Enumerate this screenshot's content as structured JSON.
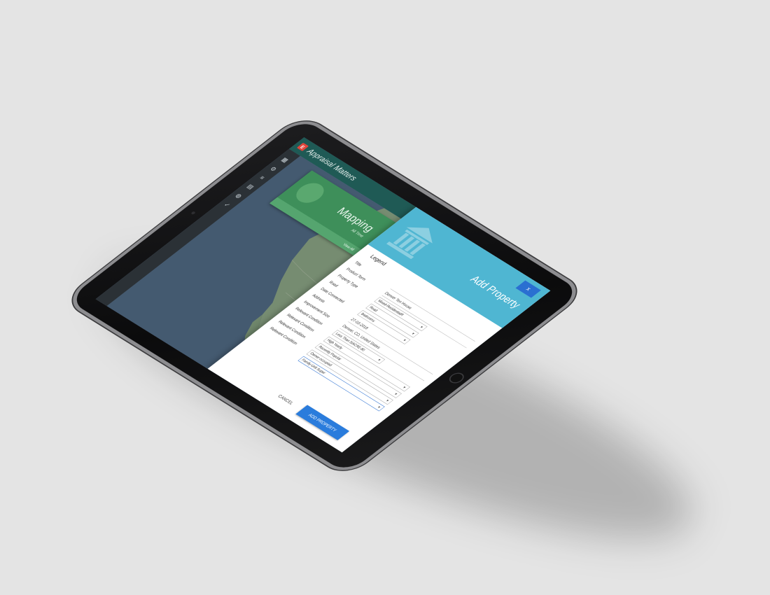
{
  "app": {
    "title": "Appraisal Matters",
    "logo": "E"
  },
  "toolbar": {
    "icons": [
      "grid-icon",
      "settings-icon",
      "layers-icon",
      "calendar-icon",
      "globe-icon",
      "check-icon"
    ]
  },
  "mapping_card": {
    "title": "Mapping",
    "subtitle": "All Time",
    "footer": "View All"
  },
  "dialog": {
    "title": "Add Property",
    "close_label": "x",
    "legend": "Legend",
    "fields": [
      {
        "label": "Title",
        "value": "",
        "kind": "line"
      },
      {
        "label": "Product Term",
        "value": "Denver Ten House",
        "kind": "line"
      },
      {
        "label": "Property Type",
        "value": "Mixed-ResidentialR",
        "kind": "select"
      },
      {
        "label": "Road",
        "value": "Road",
        "kind": "select"
      },
      {
        "label": "Date Connected",
        "value": "Bedrooms",
        "kind": "select"
      },
      {
        "label": "Address",
        "value": "27-03-2018",
        "kind": "line"
      },
      {
        "label": "Improvement Size",
        "value": "Denver, CO, United States",
        "kind": "line"
      },
      {
        "label": "Relevant Condition",
        "value": "Less Than 5/ACRE-80",
        "kind": "select"
      },
      {
        "label": "Relevant Condition",
        "value": "High Yearly",
        "kind": "select-wide"
      },
      {
        "label": "Relevant Condition",
        "value": "Recently Popular",
        "kind": "select-wide"
      },
      {
        "label": "Relevant Condition",
        "value": "Owner-occupied",
        "kind": "select-wide"
      },
      {
        "label": "",
        "value": "Family-Unit Super",
        "kind": "select-focused"
      }
    ],
    "cancel_label": "CANCEL",
    "submit_label": "ADD PROPERTY"
  },
  "colors": {
    "appbar": "#1f5a55",
    "dialog_header": "#4fb6d2",
    "primary_button": "#2a7cdc",
    "mapping_card": "#3e8f5a"
  }
}
